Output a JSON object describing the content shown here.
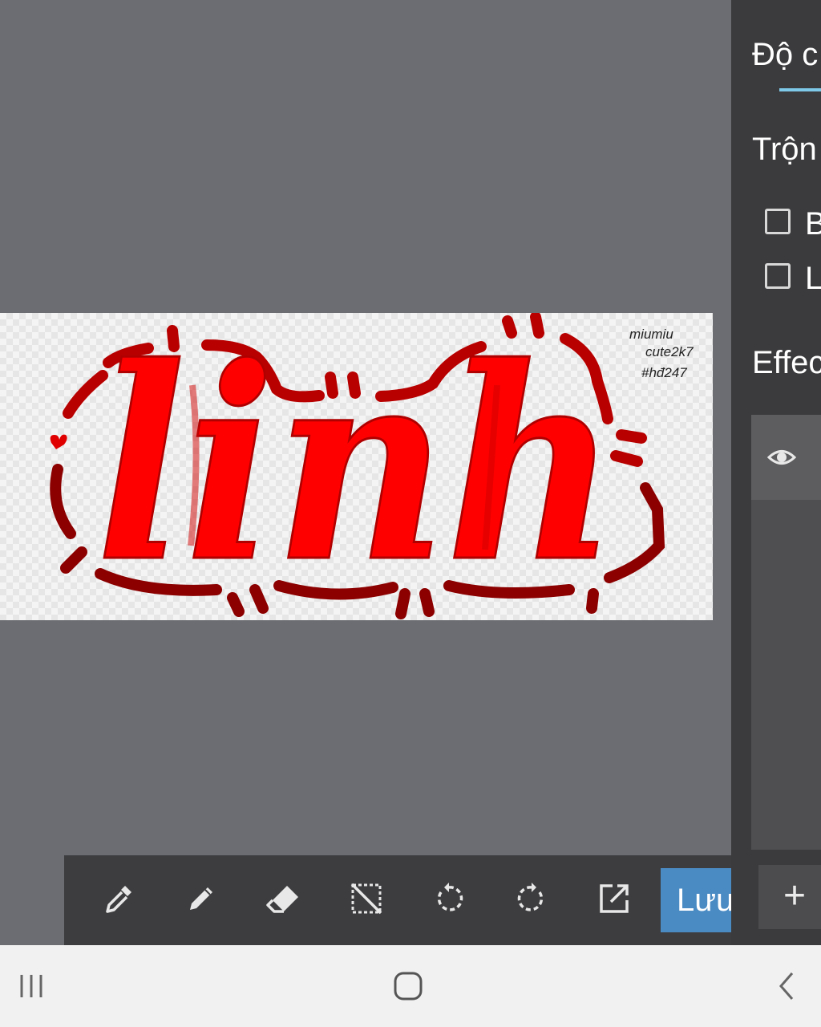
{
  "panel": {
    "tab_label": "Độ c",
    "blend_label": "Trộn",
    "checkboxes": [
      {
        "label": "B",
        "checked": false
      },
      {
        "label": "L",
        "checked": false
      }
    ],
    "effects_label": "Effec",
    "layer_eye_icon": "eye-icon",
    "add_layer_label": "+"
  },
  "toolbar": {
    "tools": [
      "eyedropper-icon",
      "pencil-icon",
      "eraser-icon",
      "deselect-icon",
      "undo-icon",
      "redo-icon",
      "export-icon"
    ],
    "save_label": "Lưu"
  },
  "canvas": {
    "main_text": "linh",
    "signature_lines": [
      "miumiu",
      "cute2k7",
      "#hđ247"
    ],
    "colors": {
      "fill": "#ff0000",
      "shade": "#e00000",
      "outline": "#b00000",
      "dark": "#8c0000"
    }
  },
  "navbar": {
    "icons": [
      "recent-apps-icon",
      "home-icon",
      "back-icon"
    ]
  }
}
